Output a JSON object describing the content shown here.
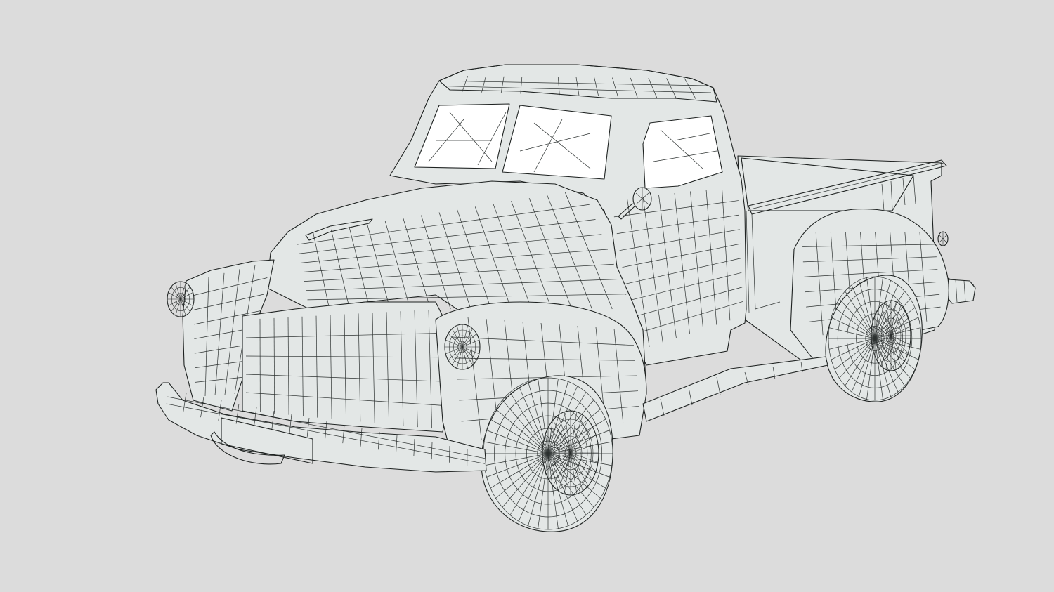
{
  "viewport": {
    "background_color": "#dcdcdc",
    "mesh_fill_color": "#e3e7e6",
    "wire_color": "#1e2221",
    "glass_color": "#ffffff"
  },
  "model": {
    "subject": "pickup-truck",
    "render_style": "wireframe-on-shaded"
  }
}
